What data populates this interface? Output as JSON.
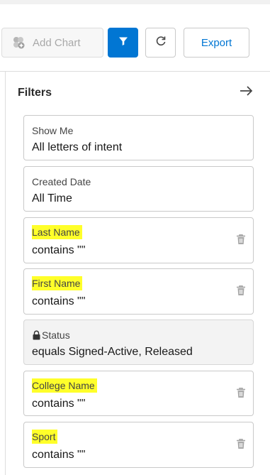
{
  "toolbar": {
    "add_chart_label": "Add Chart",
    "export_label": "Export",
    "filter_icon": "filter-icon",
    "refresh_icon": "refresh-icon",
    "accent_color": "#0176d3"
  },
  "filters_panel": {
    "title": "Filters",
    "collapse_icon": "arrow-right-icon",
    "items": [
      {
        "label": "Show Me",
        "value": "All letters of intent",
        "highlighted": false,
        "locked": false,
        "removable": false
      },
      {
        "label": "Created Date",
        "value": "All Time",
        "highlighted": false,
        "locked": false,
        "removable": false
      },
      {
        "label": "Last Name",
        "value": "contains \"\"",
        "highlighted": true,
        "locked": false,
        "removable": true
      },
      {
        "label": "First Name",
        "value": "contains \"\"",
        "highlighted": true,
        "locked": false,
        "removable": true
      },
      {
        "label": "Status",
        "value": "equals Signed-Active, Released",
        "highlighted": false,
        "locked": true,
        "removable": false
      },
      {
        "label": "College Name",
        "value": "contains \"\"",
        "highlighted": true,
        "locked": false,
        "removable": true
      },
      {
        "label": "Sport",
        "value": "contains \"\"",
        "highlighted": true,
        "locked": false,
        "removable": true
      }
    ],
    "highlight_color": "#ffff2a"
  }
}
